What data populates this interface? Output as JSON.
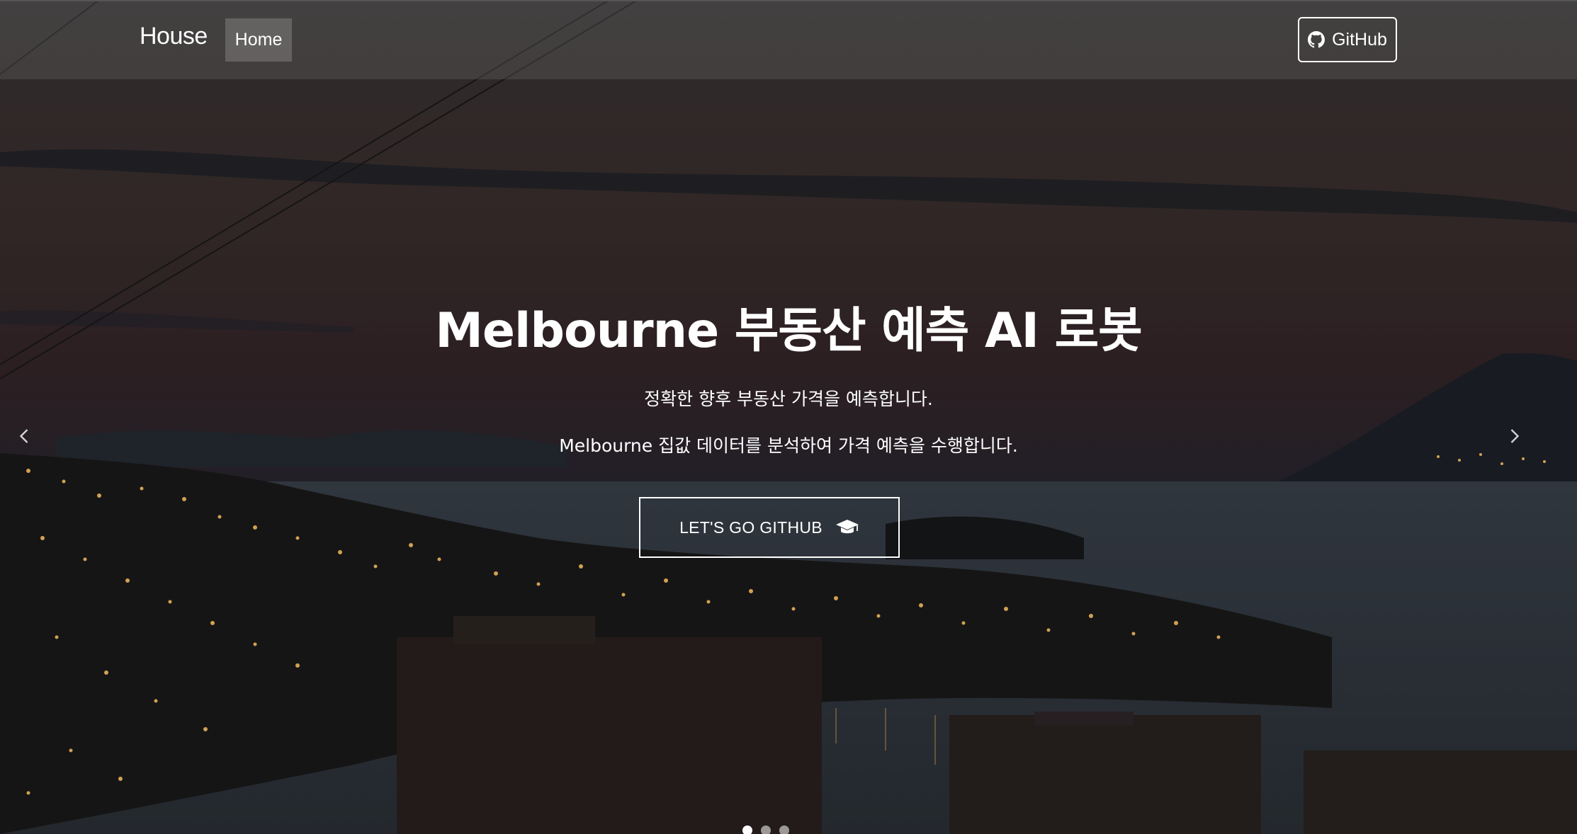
{
  "navbar": {
    "brand": "House",
    "items": [
      {
        "label": "Home",
        "active": true
      }
    ],
    "github_button": {
      "label": "GitHub",
      "icon": "github-icon"
    }
  },
  "hero": {
    "title": "Melbourne 부동산 예측 AI 로봇",
    "subtitle_1": "정확한 향후 부동산 가격을 예측합니다.",
    "subtitle_2": "Melbourne 집값 데이터를 분석하여 가격 예측을 수행합니다.",
    "cta": {
      "label": "LET'S GO GITHUB",
      "icon": "graduation-cap-icon"
    }
  },
  "carousel": {
    "prev_icon": "chevron-left-icon",
    "next_icon": "chevron-right-icon",
    "slide_count": 3,
    "active_index": 0
  },
  "colors": {
    "text": "#ffffff",
    "navbar_bg": "rgba(120,120,120,0.28)",
    "overlay": "#1a1a1d"
  }
}
